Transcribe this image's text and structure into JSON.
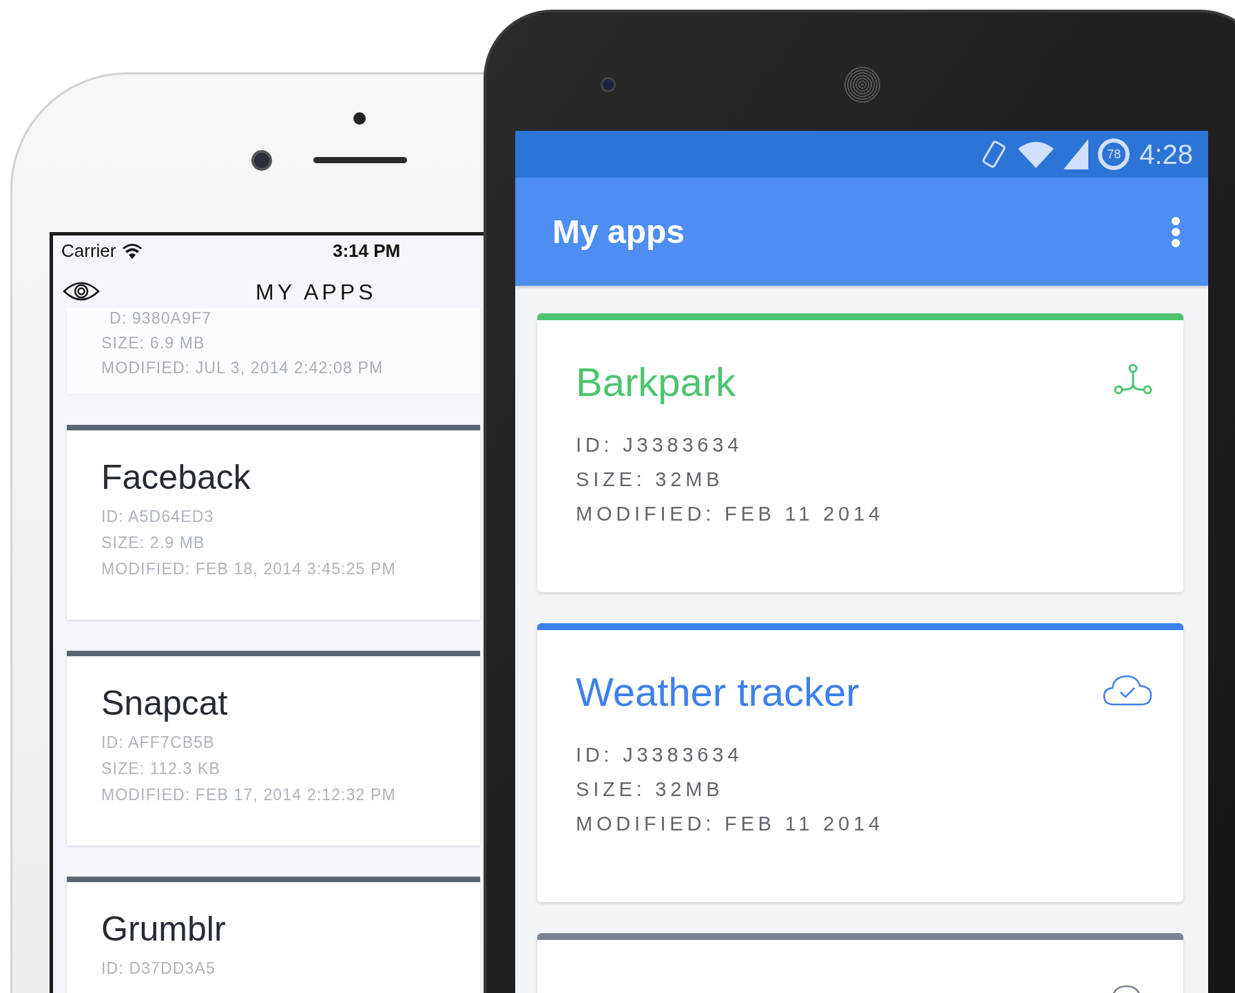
{
  "ios_phone": {
    "status_bar": {
      "carrier": "Carrier",
      "time": "3:14 PM"
    },
    "nav_title": "MY APPS",
    "partial_app": {
      "id": "D: 9380A9F7",
      "size": "SIZE: 6.9 MB",
      "modified": "MODIFIED: JUL 3, 2014 2:42:08 PM"
    },
    "apps": [
      {
        "name": "Faceback",
        "id": "ID: A5D64ED3",
        "size": "SIZE: 2.9 MB",
        "modified": "MODIFIED: FEB 18, 2014 3:45:25 PM"
      },
      {
        "name": "Snapcat",
        "id": "ID: AFF7CB5B",
        "size": "SIZE: 112.3 KB",
        "modified": "MODIFIED: FEB 17, 2014 2:12:32 PM"
      },
      {
        "name": "Grumblr",
        "id": "ID: D37DD3A5"
      }
    ]
  },
  "android_phone": {
    "status_bar": {
      "battery": "78",
      "time": "4:28"
    },
    "toolbar_title": "My apps",
    "apps": [
      {
        "kind": "branch",
        "color": "#4cc46f",
        "name": "Barkpark",
        "id": "ID: J3383634",
        "size": "SIZE: 32MB",
        "modified": "MODIFIED: FEB 11 2014"
      },
      {
        "kind": "cloud",
        "color": "#3d80ee",
        "name": "Weather tracker",
        "id": "ID: J3383634",
        "size": "SIZE: 32MB",
        "modified": "MODIFIED: FEB 11 2014"
      },
      {
        "kind": "cloud",
        "color": "#7b8591"
      }
    ]
  }
}
